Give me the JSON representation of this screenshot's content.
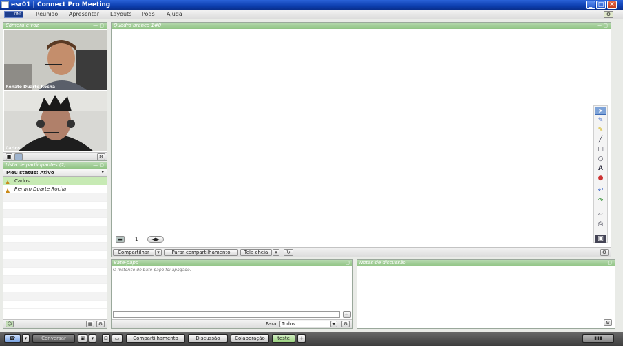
{
  "window": {
    "title": "esr01 | Connect Pro Meeting",
    "min": "_",
    "max": "□",
    "close": "✕"
  },
  "menu": {
    "items": [
      "Reunião",
      "Apresentar",
      "Layouts",
      "Pods",
      "Ajuda"
    ],
    "logo": "RNP"
  },
  "camera_pod": {
    "title": "Câmera e voz",
    "ctl": "— ▢",
    "videos": [
      {
        "name": "Renato Duarte Rocha"
      },
      {
        "name": "Carlos"
      }
    ]
  },
  "attendee_pod": {
    "title": "Lista de participantes (2)",
    "ctl": "— ▢",
    "status_label": "Meu status: Ativo",
    "participants": [
      {
        "name": "Carlos",
        "highlight": true
      },
      {
        "name": "Renato Duarte Rocha",
        "highlight": false
      }
    ]
  },
  "whiteboard_pod": {
    "title": "Quadro branco 1#0",
    "ctl": "— ▢",
    "page": "1",
    "tools": [
      "select-icon",
      "pencil-icon",
      "highlighter-icon",
      "line-icon",
      "rectangle-icon",
      "ellipse-icon",
      "text-icon",
      "stamp-icon",
      "undo-icon",
      "redo-icon",
      "eraser-icon",
      "print-icon",
      "options-icon"
    ],
    "text_tool_label": "A"
  },
  "share_bar": {
    "share": "Compartilhar",
    "stop_share": "Parar compartilhamento",
    "fullscreen": "Tela cheia"
  },
  "chat_pod": {
    "title": "Bate-papo",
    "ctl": "— ▢",
    "history_notice": "O histórico de bate-papo foi apagado.",
    "to_label": "Para:",
    "to_value": "Todos"
  },
  "notes_pod": {
    "title": "Notas de discussão",
    "ctl": "— ▢"
  },
  "taskbar": {
    "converse": "Conversar",
    "tabs": [
      "Compartilhamento",
      "Discussão",
      "Colaboração",
      "teste"
    ],
    "add": "+"
  }
}
